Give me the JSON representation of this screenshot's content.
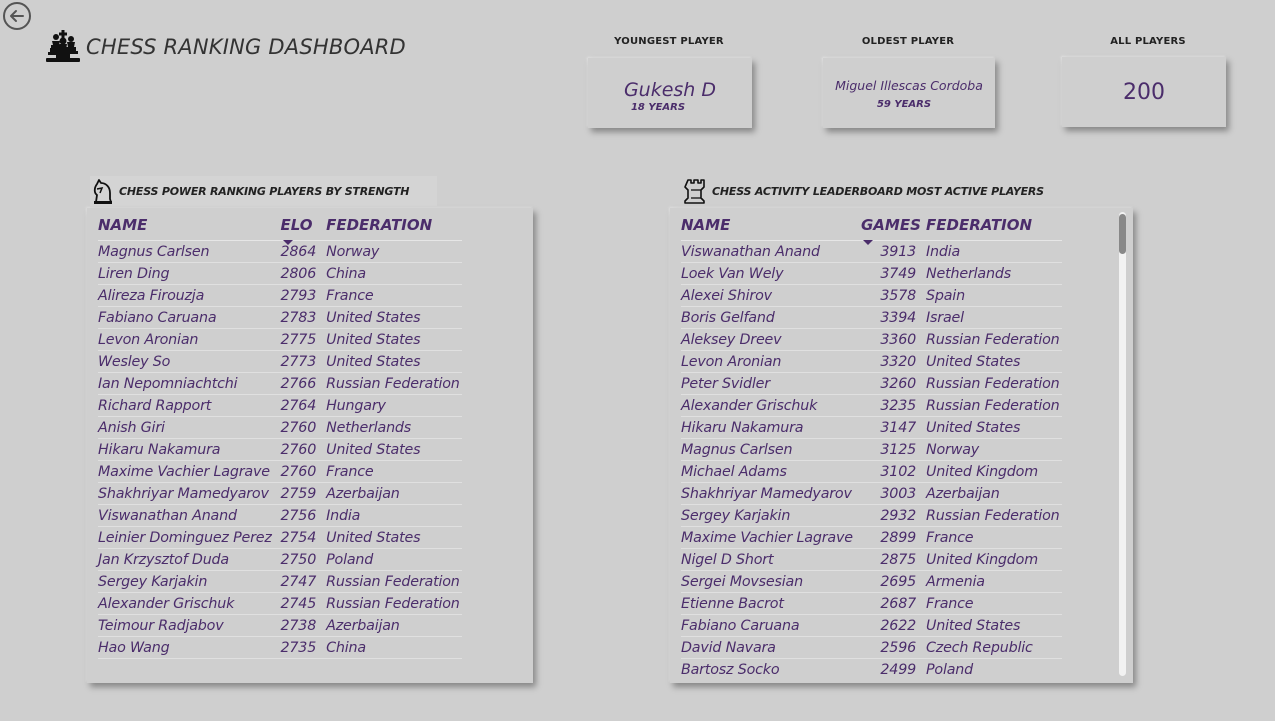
{
  "header": {
    "title": "CHESS RANKING DASHBOARD"
  },
  "kpis": {
    "youngest": {
      "label": "YOUNGEST PLAYER",
      "name": "Gukesh D",
      "sub": "18 YEARS"
    },
    "oldest": {
      "label": "OLDEST PLAYER",
      "name": "Miguel Illescas Cordoba",
      "sub": "59 YEARS"
    },
    "all": {
      "label": "ALL PLAYERS",
      "value": "200"
    }
  },
  "power": {
    "title": "CHESS POWER RANKING PLAYERS BY STRENGTH",
    "columns": [
      "NAME",
      "ELO",
      "FEDERATION"
    ],
    "rows": [
      [
        "Magnus Carlsen",
        "2864",
        "Norway"
      ],
      [
        "Liren Ding",
        "2806",
        "China"
      ],
      [
        "Alireza Firouzja",
        "2793",
        "France"
      ],
      [
        "Fabiano Caruana",
        "2783",
        "United States"
      ],
      [
        "Levon Aronian",
        "2775",
        "United States"
      ],
      [
        "Wesley So",
        "2773",
        "United States"
      ],
      [
        "Ian Nepomniachtchi",
        "2766",
        "Russian Federation"
      ],
      [
        "Richard Rapport",
        "2764",
        "Hungary"
      ],
      [
        "Anish Giri",
        "2760",
        "Netherlands"
      ],
      [
        "Hikaru Nakamura",
        "2760",
        "United States"
      ],
      [
        "Maxime Vachier Lagrave",
        "2760",
        "France"
      ],
      [
        "Shakhriyar Mamedyarov",
        "2759",
        "Azerbaijan"
      ],
      [
        "Viswanathan Anand",
        "2756",
        "India"
      ],
      [
        "Leinier Dominguez Perez",
        "2754",
        "United States"
      ],
      [
        "Jan Krzysztof Duda",
        "2750",
        "Poland"
      ],
      [
        "Sergey Karjakin",
        "2747",
        "Russian Federation"
      ],
      [
        "Alexander Grischuk",
        "2745",
        "Russian Federation"
      ],
      [
        "Teimour Radjabov",
        "2738",
        "Azerbaijan"
      ],
      [
        "Hao Wang",
        "2735",
        "China"
      ]
    ]
  },
  "activity": {
    "title": "CHESS ACTIVITY LEADERBOARD MOST ACTIVE PLAYERS",
    "columns": [
      "NAME",
      "GAMES",
      "FEDERATION"
    ],
    "rows": [
      [
        "Viswanathan Anand",
        "3913",
        "India"
      ],
      [
        "Loek Van Wely",
        "3749",
        "Netherlands"
      ],
      [
        "Alexei Shirov",
        "3578",
        "Spain"
      ],
      [
        "Boris Gelfand",
        "3394",
        "Israel"
      ],
      [
        "Aleksey Dreev",
        "3360",
        "Russian Federation"
      ],
      [
        "Levon Aronian",
        "3320",
        "United States"
      ],
      [
        "Peter Svidler",
        "3260",
        "Russian Federation"
      ],
      [
        "Alexander Grischuk",
        "3235",
        "Russian Federation"
      ],
      [
        "Hikaru Nakamura",
        "3147",
        "United States"
      ],
      [
        "Magnus Carlsen",
        "3125",
        "Norway"
      ],
      [
        "Michael Adams",
        "3102",
        "United Kingdom"
      ],
      [
        "Shakhriyar Mamedyarov",
        "3003",
        "Azerbaijan"
      ],
      [
        "Sergey Karjakin",
        "2932",
        "Russian Federation"
      ],
      [
        "Maxime Vachier Lagrave",
        "2899",
        "France"
      ],
      [
        "Nigel D Short",
        "2875",
        "United Kingdom"
      ],
      [
        "Sergei Movsesian",
        "2695",
        "Armenia"
      ],
      [
        "Etienne Bacrot",
        "2687",
        "France"
      ],
      [
        "Fabiano Caruana",
        "2622",
        "United States"
      ],
      [
        "David Navara",
        "2596",
        "Czech Republic"
      ],
      [
        "Bartosz Socko",
        "2499",
        "Poland"
      ]
    ]
  },
  "colors": {
    "accent": "#4b2d6b",
    "background": "#cfcfcf"
  },
  "icons": [
    "back-arrow-icon",
    "chess-pieces-icon",
    "chess-knight-icon",
    "chess-rook-icon"
  ]
}
